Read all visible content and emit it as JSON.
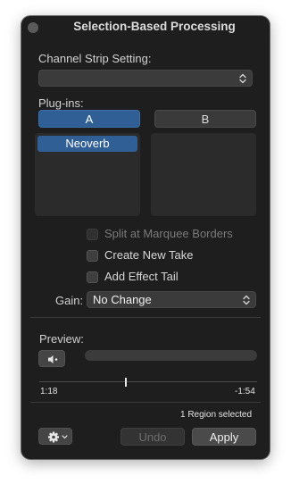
{
  "window": {
    "title": "Selection-Based Processing"
  },
  "channel_strip": {
    "label": "Channel Strip Setting:",
    "value": ""
  },
  "plugins": {
    "label": "Plug-ins:",
    "tab_a": "A",
    "tab_b": "B",
    "list_a": [
      "Neoverb"
    ],
    "list_b": []
  },
  "options": {
    "split_marquee": {
      "label": "Split at Marquee Borders",
      "checked": false,
      "enabled": false
    },
    "create_take": {
      "label": "Create New Take",
      "checked": false,
      "enabled": true
    },
    "effect_tail": {
      "label": "Add Effect Tail",
      "checked": false,
      "enabled": true
    }
  },
  "gain": {
    "label": "Gain:",
    "value": "No Change"
  },
  "preview": {
    "label": "Preview:",
    "start_time": "1:18",
    "end_time": "-1:54"
  },
  "footer": {
    "status": "1 Region selected",
    "undo_label": "Undo",
    "apply_label": "Apply"
  },
  "colors": {
    "accent": "#2f5f95",
    "window_bg": "#1e1e1e"
  }
}
